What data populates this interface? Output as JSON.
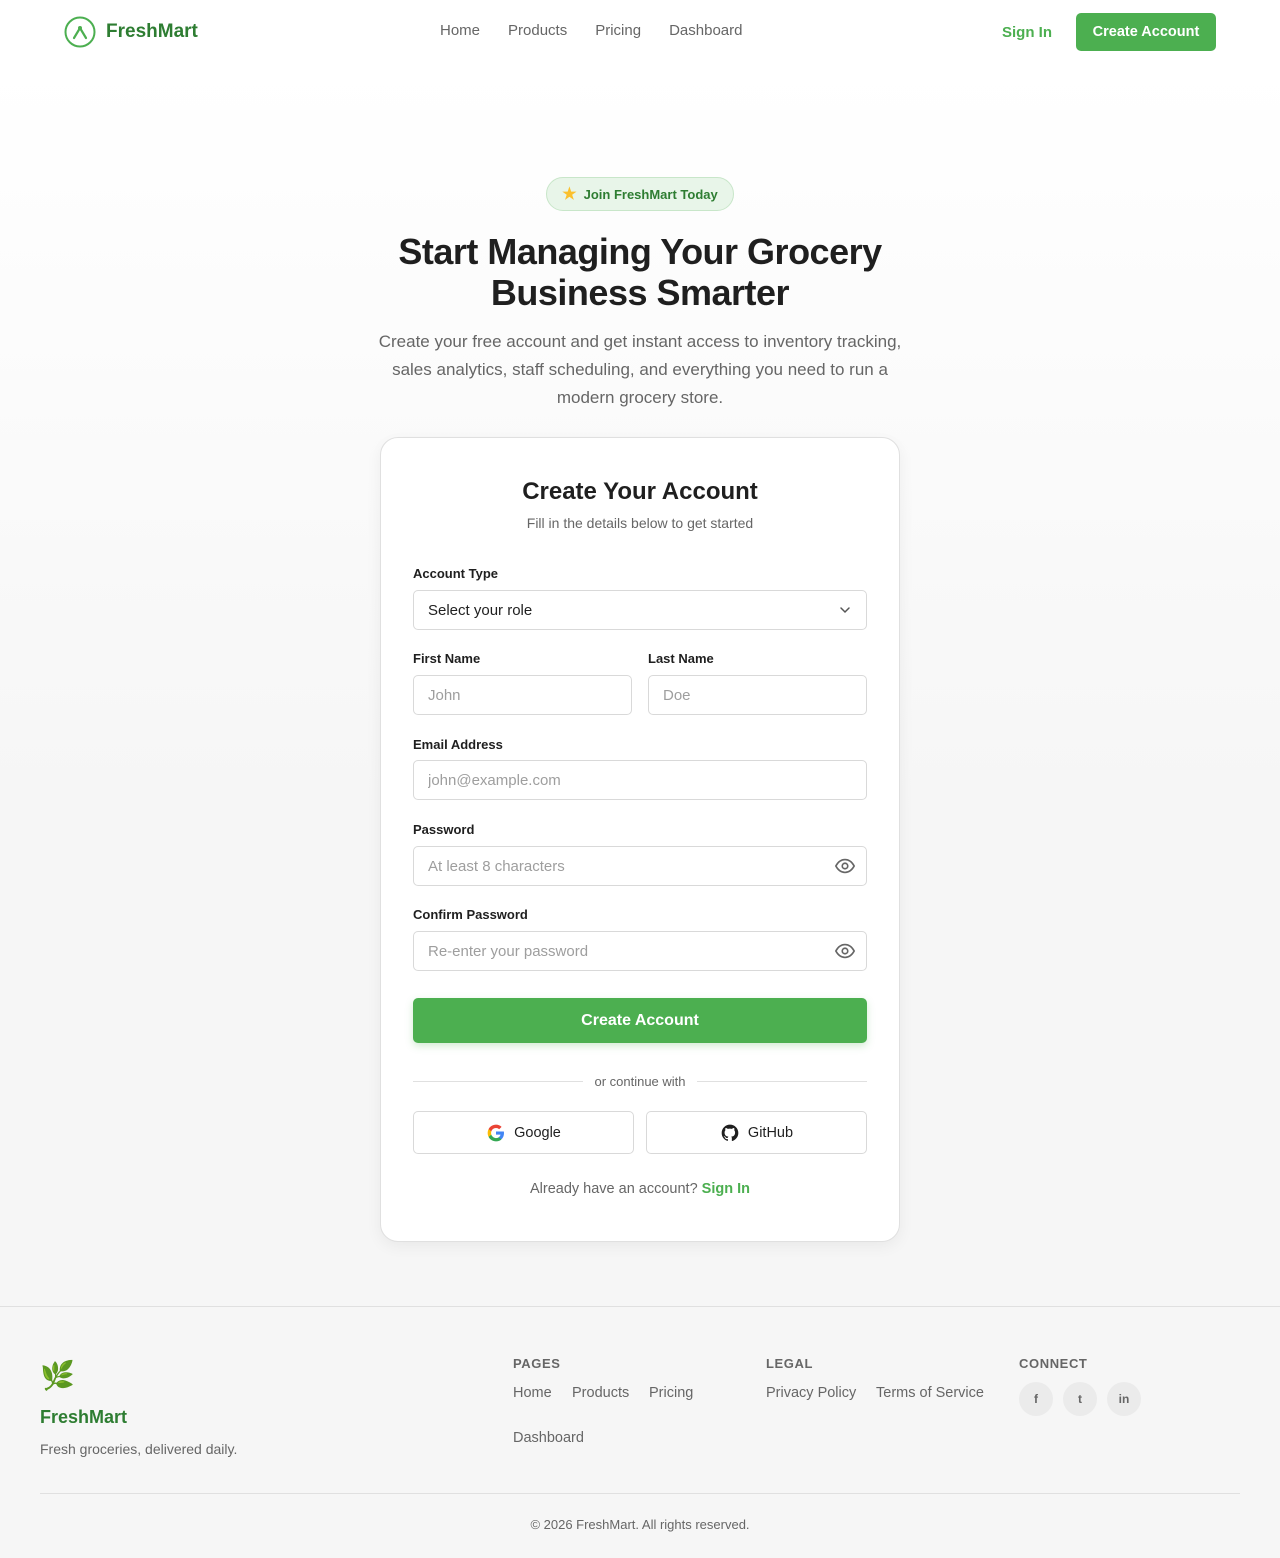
{
  "brand": {
    "name": "FreshMart",
    "accent": "#4caf50",
    "dark_accent": "#2e7d32",
    "logo_icon": "sprout-circle-icon"
  },
  "nav": {
    "items": [
      "Home",
      "Products",
      "Pricing",
      "Dashboard"
    ],
    "signin": "Sign In",
    "cta": "Create Account"
  },
  "hero": {
    "badge": "Join FreshMart Today",
    "badge_icon": "star-icon",
    "title": "Start Managing Your Grocery Business Smarter",
    "subtitle": "Create your free account and get instant access to inventory tracking, sales analytics, staff scheduling, and everything you need to run a modern grocery store."
  },
  "form": {
    "title": "Create Your Account",
    "subtitle": "Fill in the details below to get started",
    "account_type": {
      "label": "Account Type",
      "value": "Select your role"
    },
    "first_name": {
      "label": "First Name",
      "placeholder": "John"
    },
    "last_name": {
      "label": "Last Name",
      "placeholder": "Doe"
    },
    "email": {
      "label": "Email Address",
      "placeholder": "john@example.com"
    },
    "password": {
      "label": "Password",
      "placeholder": "At least 8 characters"
    },
    "confirm": {
      "label": "Confirm Password",
      "placeholder": "Re-enter your password"
    },
    "submit": "Create Account",
    "divider": "or continue with",
    "google": "Google",
    "github": "GitHub",
    "already_text": "Already have an account?",
    "already_link": "Sign In"
  },
  "footer": {
    "brand": "FreshMart",
    "tagline": "Fresh groceries, delivered daily.",
    "leaf": "🌿",
    "pages_heading": "PAGES",
    "pages": [
      "Home",
      "Products",
      "Pricing",
      "Dashboard"
    ],
    "legal_heading": "LEGAL",
    "legal": [
      "Privacy Policy",
      "Terms of Service"
    ],
    "connect_heading": "CONNECT",
    "social": [
      "f",
      "t",
      "in"
    ],
    "copyright": "© 2026 FreshMart. All rights reserved."
  }
}
